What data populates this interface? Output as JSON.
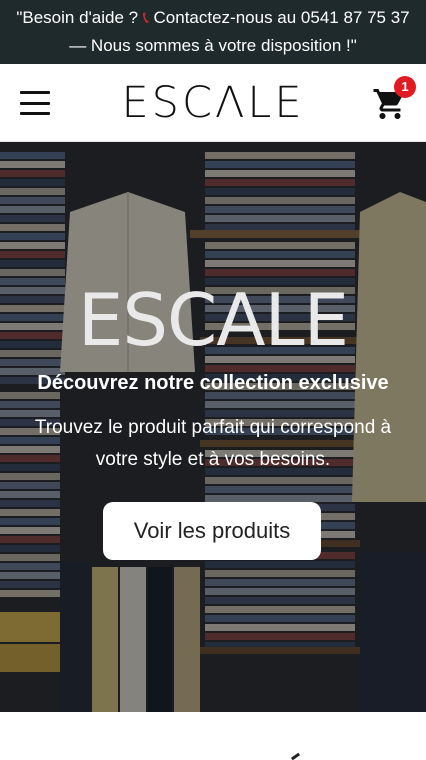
{
  "announcement": {
    "text_before": "\"Besoin d'aide ? ",
    "phone_icon": "phone-icon",
    "text_after": " Contactez-nous au 0541 87 75 37 — Nous sommes à votre disposition !\""
  },
  "header": {
    "menu_icon": "hamburger-menu-icon",
    "logo": "ESCΛLE",
    "cart_icon": "shopping-cart-icon",
    "cart_count": "1"
  },
  "hero": {
    "title": "ESCALE",
    "subtitle": "Découvrez notre collection exclusive",
    "text": "Trouvez le produit parfait qui correspond à votre style et à vos besoins.",
    "cta_label": "Voir les produits"
  },
  "colors": {
    "announcement_bg": "#1f2a2c",
    "badge": "#e01b24",
    "phone": "#d42a2a"
  }
}
